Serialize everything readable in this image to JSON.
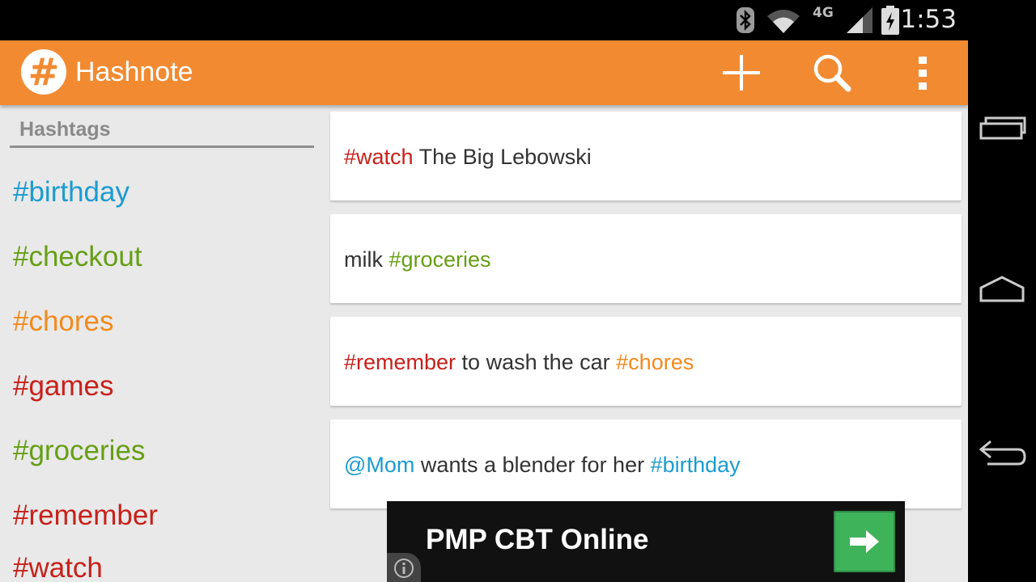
{
  "status_bar": {
    "time": "1:53",
    "network": "4G",
    "icons": [
      "bluetooth-icon",
      "wifi-icon",
      "signal-icon",
      "battery-charging-icon"
    ]
  },
  "action_bar": {
    "title": "Hashnote",
    "logo_glyph": "#",
    "actions": [
      "add-icon",
      "search-icon",
      "overflow-menu-icon"
    ],
    "color": "#f28a31"
  },
  "sidebar": {
    "header": "Hashtags",
    "tags": [
      {
        "label": "#birthday",
        "color": "#1b9bd1"
      },
      {
        "label": "#checkout",
        "color": "#669e14"
      },
      {
        "label": "#chores",
        "color": "#f28a1e"
      },
      {
        "label": "#games",
        "color": "#c8201a"
      },
      {
        "label": "#groceries",
        "color": "#669e14"
      },
      {
        "label": "#remember",
        "color": "#c8201a"
      },
      {
        "label": "#watch",
        "color": "#c8201a"
      }
    ]
  },
  "notes": [
    {
      "segments": [
        {
          "text": "#watch",
          "color": "#c8201a"
        },
        {
          "text": " The Big Lebowski",
          "color": "#333333"
        }
      ]
    },
    {
      "segments": [
        {
          "text": "milk ",
          "color": "#333333"
        },
        {
          "text": "#groceries",
          "color": "#669e14"
        }
      ]
    },
    {
      "segments": [
        {
          "text": "#remember",
          "color": "#c8201a"
        },
        {
          "text": " to wash the car ",
          "color": "#333333"
        },
        {
          "text": "#chores",
          "color": "#f28a1e"
        }
      ]
    },
    {
      "segments": [
        {
          "text": "@Mom",
          "color": "#1b9bd1"
        },
        {
          "text": " wants a blender for her ",
          "color": "#333333"
        },
        {
          "text": "#birthday",
          "color": "#1b9bd1"
        }
      ]
    }
  ],
  "ad": {
    "text": "PMP CBT Online",
    "button_icon": "arrow-right-icon",
    "info_icon": "info-icon"
  },
  "nav_bar": {
    "buttons": [
      "recent-apps-icon",
      "home-icon",
      "back-icon"
    ]
  }
}
